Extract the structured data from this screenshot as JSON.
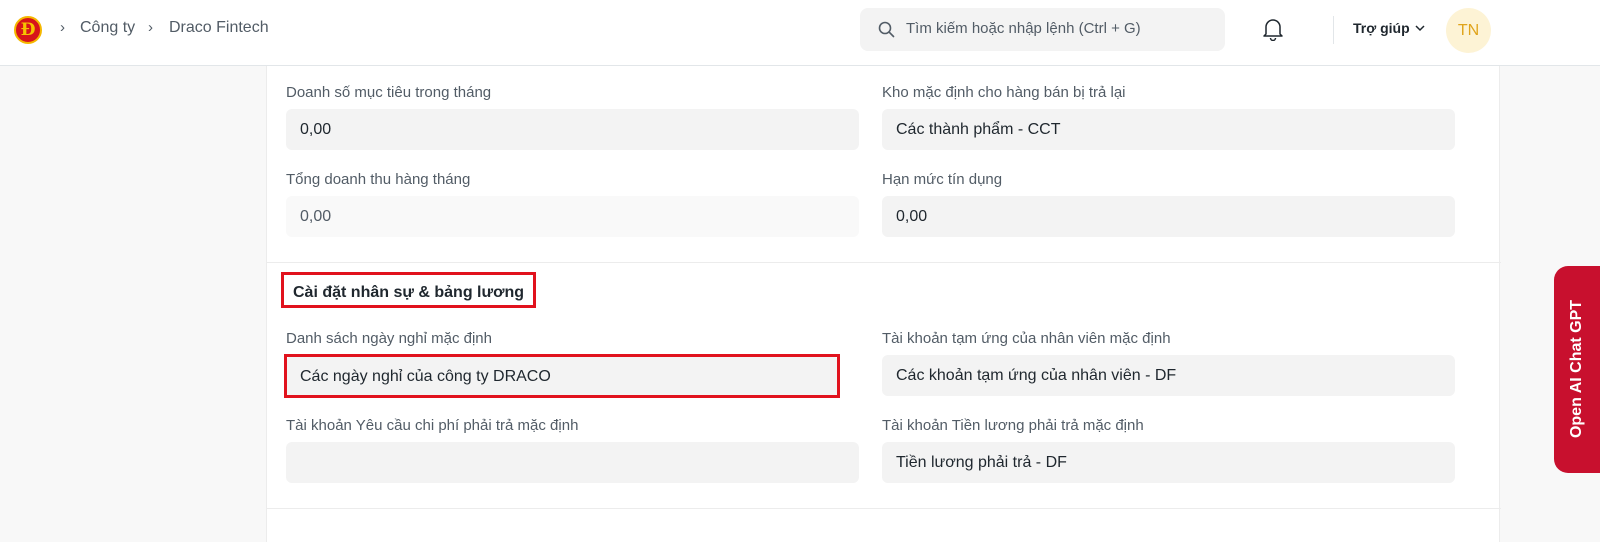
{
  "navbar": {
    "logo_letter": "Đ",
    "breadcrumbs": [
      "Công ty",
      "Draco Fintech"
    ],
    "search_placeholder": "Tìm kiếm hoặc nhập lệnh (Ctrl + G)",
    "help_label": "Trợ giúp",
    "avatar_initials": "TN"
  },
  "form": {
    "fields_top": [
      {
        "label": "Doanh số mục tiêu trong tháng",
        "value": "0,00"
      },
      {
        "label": "Kho mặc định cho hàng bán bị trả lại",
        "value": "Các thành phẩm - CCT"
      },
      {
        "label": "Tổng doanh thu hàng tháng",
        "value": "0,00"
      },
      {
        "label": "Hạn mức tín dụng",
        "value": "0,00"
      }
    ],
    "hr_section": {
      "title": "Cài đặt nhân sự & bảng lương",
      "fields": [
        {
          "label": "Danh sách ngày nghỉ mặc định",
          "value": "Các ngày nghỉ của công ty DRACO"
        },
        {
          "label": "Tài khoản tạm ứng của nhân viên mặc định",
          "value": "Các khoản tạm ứng của nhân viên - DF"
        },
        {
          "label": "Tài khoản Yêu cầu chi phí phải trả mặc định",
          "value": ""
        },
        {
          "label": "Tài khoản Tiền lương phải trả mặc định",
          "value": "Tiền lương phải trả - DF"
        }
      ]
    }
  },
  "side_tab": {
    "label": "Open AI Chat GPT"
  },
  "colors": {
    "highlight": "#e1121d",
    "side_tab": "#c8102e",
    "avatar_bg": "#fdf3d5",
    "avatar_text": "#e0a41b"
  }
}
